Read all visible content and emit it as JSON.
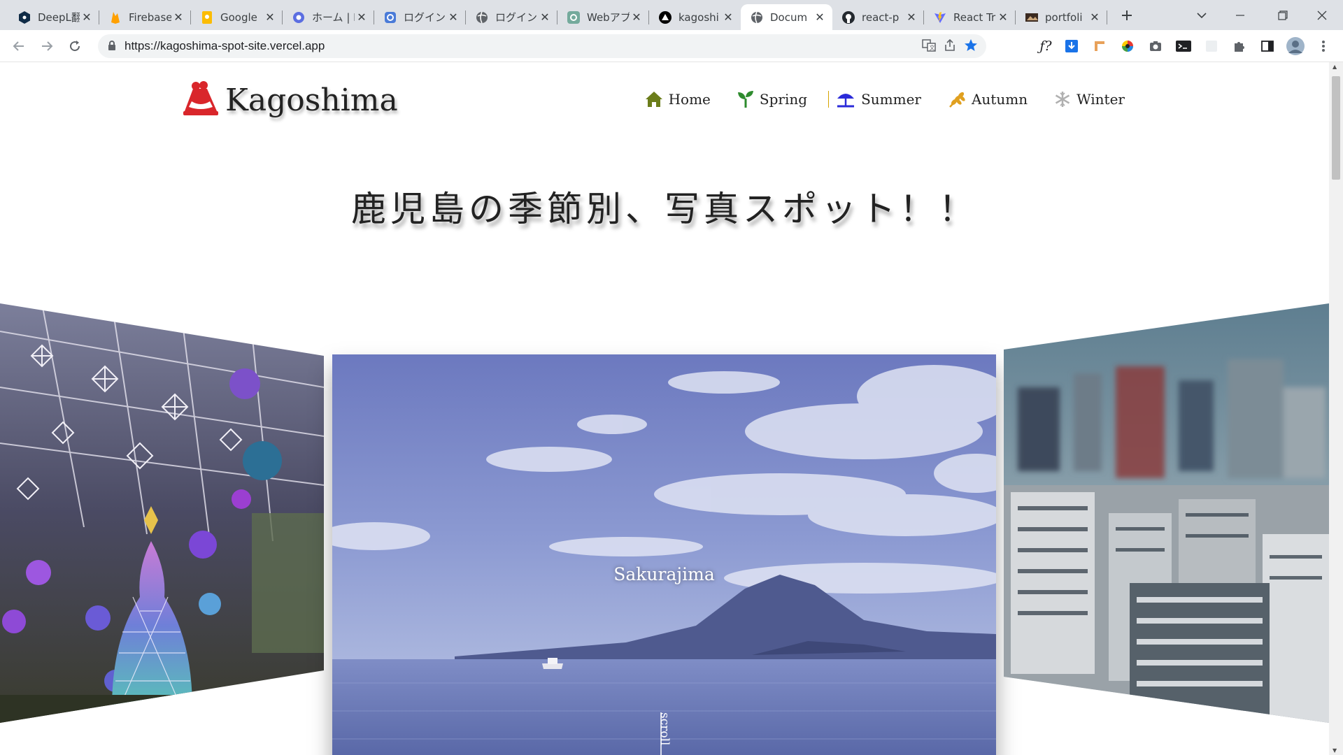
{
  "browser": {
    "tabs": [
      {
        "title": "DeepL翻訳",
        "icon": "deepl-icon"
      },
      {
        "title": "Firebase",
        "icon": "firebase-icon"
      },
      {
        "title": "Google",
        "icon": "google-keep-icon"
      },
      {
        "title": "ホーム | M",
        "icon": "app-icon"
      },
      {
        "title": "ログイン画",
        "icon": "login-icon"
      },
      {
        "title": "ログイン|",
        "icon": "globe-icon"
      },
      {
        "title": "Webアプ",
        "icon": "chatgpt-icon"
      },
      {
        "title": "kagoshi",
        "icon": "vercel-icon"
      },
      {
        "title": "Docum",
        "icon": "globe-icon"
      },
      {
        "title": "react-p",
        "icon": "github-icon"
      },
      {
        "title": "React Tr",
        "icon": "vite-icon"
      },
      {
        "title": "portfoli",
        "icon": "portfolio-icon"
      }
    ],
    "active_tab_index": 8,
    "url": "https://kagoshima-spot-site.vercel.app"
  },
  "site": {
    "logo_text": "Kagoshima",
    "nav": [
      {
        "label": "Home",
        "icon": "home-icon",
        "color": "#6b7d1a"
      },
      {
        "label": "Spring",
        "icon": "sprout-icon",
        "color": "#2e8b2e"
      },
      {
        "label": "Summer",
        "icon": "beach-umbrella-icon",
        "color": "#2b2bd9"
      },
      {
        "label": "Autumn",
        "icon": "wheat-icon",
        "color": "#e0a020"
      },
      {
        "label": "Winter",
        "icon": "snowflake-icon",
        "color": "#b0b0b0"
      }
    ],
    "headline": "鹿児島の季節別、写真スポット！！",
    "slides": [
      {
        "caption": "Sakurajima"
      }
    ],
    "scroll_label": "scroll"
  },
  "colors": {
    "logo_red": "#d9262b",
    "tab_strip": "#dee1e6"
  }
}
